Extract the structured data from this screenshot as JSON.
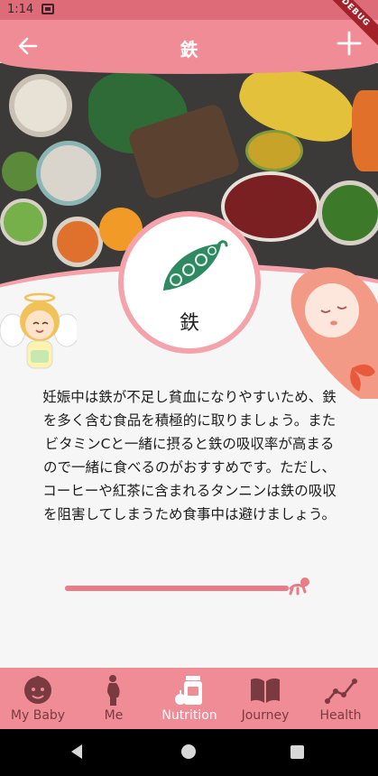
{
  "status_bar": {
    "time": "1:14"
  },
  "debug_banner": "DEBUG",
  "app_bar": {
    "title": "鉄",
    "back_icon": "arrow-left-icon",
    "add_icon": "plus-icon"
  },
  "nutrient": {
    "name": "鉄",
    "icon": "pea-pod-icon",
    "icon_color": "#2f8a62"
  },
  "description": "妊娠中は鉄が不足し貧血になりやすいため、鉄を多く含む食品を積極的に取りましょう。またビタミンCと一緒に摂ると鉄の吸収率が高まるので一緒に食べるのがおすすめです。ただし、コーヒーや紅茶に含まれるタンニンは鉄の吸収を阻害してしまうため食事中は避けましょう。",
  "progress": {
    "value": 1.0,
    "color": "#e87d88"
  },
  "bottom_nav": [
    {
      "label": "My Baby",
      "icon": "baby-face-icon",
      "active": false
    },
    {
      "label": "Me",
      "icon": "pregnant-woman-icon",
      "active": false
    },
    {
      "label": "Nutrition",
      "icon": "food-jar-icon",
      "active": true
    },
    {
      "label": "Journey",
      "icon": "open-book-icon",
      "active": false
    },
    {
      "label": "Health",
      "icon": "line-chart-icon",
      "active": false
    }
  ],
  "colors": {
    "primary": "#f08c96",
    "accent": "#f4a3ab",
    "nav_inactive": "#7a3b40",
    "status_bar": "#dd6c78"
  }
}
